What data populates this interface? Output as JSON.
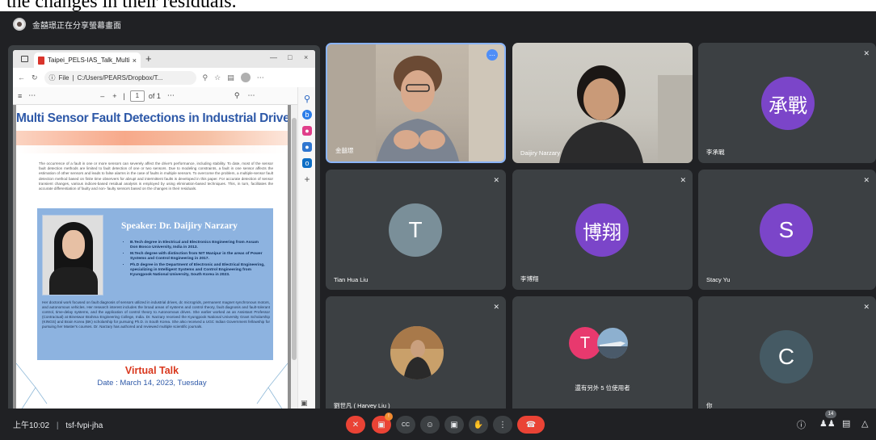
{
  "top_text": "the changes in their residuals.",
  "share_banner": "金囍璟正在分享螢幕畫面",
  "browser": {
    "tab_title": "Taipei_PELS-IAS_Talk_MultiSenso",
    "tab_close": "×",
    "new_tab": "+",
    "win_min": "—",
    "win_max": "□",
    "win_close": "×",
    "url_prefix": "File",
    "url": "C:/Users/PEARS/Dropbox/T...",
    "pdf_page": "1",
    "pdf_of": "of 1"
  },
  "pdf": {
    "title": "Multi Sensor Fault Detections in Industrial Drives",
    "abstract": "The occurrence of a fault in one or more sensors can severely affect the drive's performance, including stability. To date, most of the sensor fault detection methods are limited to fault detection of one or two sensors. Due to modeling constraints, a fault in one sensor affects the estimation of other sensors and leads to false alarms in the case of faults in multiple sensors. To overcome the problem, a multiple-sensor fault detection method based on finite time observers for abrupt and intermittent faults is developed in this paper. For accurate detection of sensor transient changes, various indices-based residual analysis is employed by using elimination-based techniques. This, in turn, facilitates the accurate differentiation of faulty and non- faulty sensors based on the changes in their residuals.",
    "speaker": "Speaker:  Dr. Daijiry Narzary",
    "degrees": [
      "B.Tech degree in Electrical and Electronics Engineering from Assam Don Bosco University, India in 2013.",
      "M.Tech degree with distinction from NIT Manipur in the areas of Power Systems and Control Engineering in 2017.",
      "Ph.D degree in the Department of Electronic and Electrical Engineering, specializing in Intelligent Systems and Control Engineering from Kyungpook National University, South Korea in 2023."
    ],
    "bio": "Her doctoral work focused on fault diagnosis of sensors utilized in industrial drives, dc microgrids, permanent magnet synchronous motors, and autonomous vehicles. Her research interest includes the broad areas of systems and control theory, fault diagnosis and fault-tolerant control, time-delay systems, and the application of control theory to Autonomous drives. She earlier worked as an Assistant Professor (Contractual) at Bineswar Brahma Engineering College, India. Dr. Narzary received the Kyungpook National University Grant Scholarship (KINGS) and Brain Korea (BK) scholarship for pursuing Ph.D. in South Korea. She also received a UGC Indian Government fellowship for pursuing her Master's courses. Dr. Narzary has authored and reviewed multiple scientific journals.",
    "virtual_talk": "Virtual Talk",
    "date": "Date :  March 14, 2023, Tuesday"
  },
  "participants": {
    "p1": {
      "name": "金囍璟"
    },
    "p2": {
      "name": "Daijiry Narzary"
    },
    "p3": {
      "name": "李承戰",
      "avatar": "承戰",
      "color": "#7b45c9"
    },
    "p4": {
      "name": "Tian Hua Liu",
      "avatar": "T",
      "color": "#7a8f99"
    },
    "p5": {
      "name": "李博翔",
      "avatar": "博翔",
      "color": "#7b45c9"
    },
    "p6": {
      "name": "Stacy Yu",
      "avatar": "S",
      "color": "#7b45c9"
    },
    "p7": {
      "name": "劉世凡 ( Harvey Liu )"
    },
    "p8": {
      "name": "還有另外 5 位使用者",
      "avatar": "T",
      "color": "#e8396e"
    },
    "p9": {
      "name": "你",
      "avatar": "C",
      "color": "#455a64"
    }
  },
  "bottom": {
    "time": "上午10:02",
    "meeting_code": "tsf-fvpi-jha",
    "people_count": "14",
    "cam_badge": "!"
  }
}
